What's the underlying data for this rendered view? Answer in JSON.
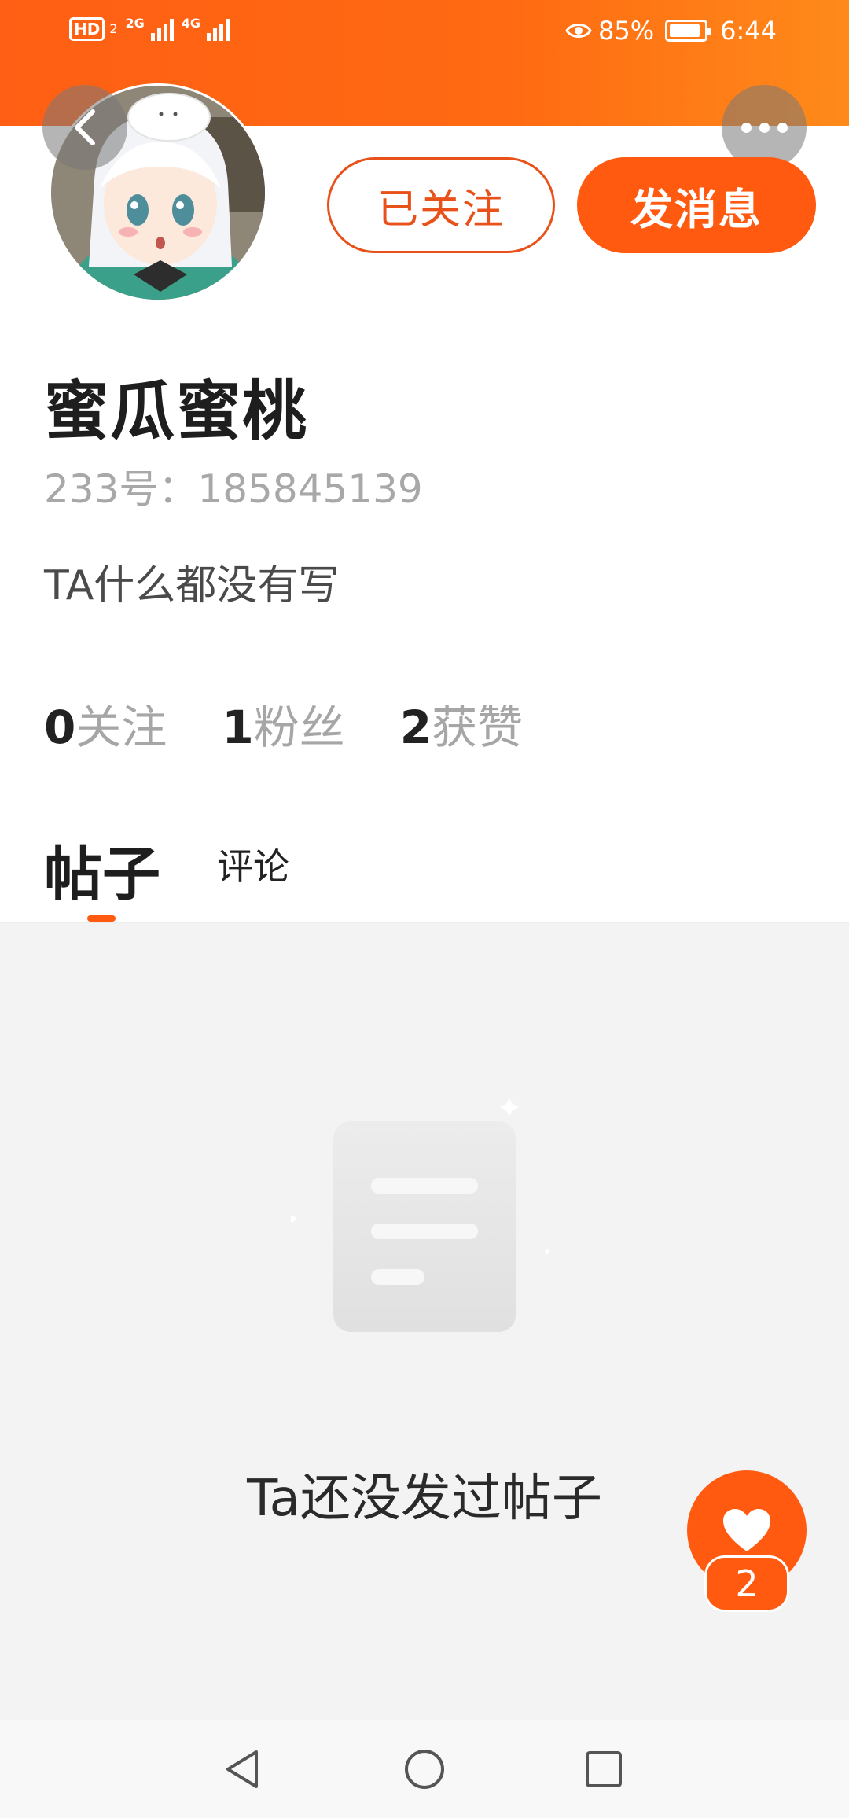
{
  "status_bar": {
    "hd_label": "HD",
    "sim_number": "2",
    "net_type_1": "2G",
    "net_type_2": "4G",
    "battery_percent": "85%",
    "time": "6:44"
  },
  "header": {
    "back_icon": "chevron-left-icon",
    "more_icon": "more-horizontal-icon"
  },
  "profile": {
    "follow_button": "已关注",
    "message_button": "发消息",
    "username": "蜜瓜蜜桃",
    "id_text": "233号：185845139",
    "bio": "TA什么都没有写",
    "stats": [
      {
        "count": "0",
        "label": "关注"
      },
      {
        "count": "1",
        "label": "粉丝"
      },
      {
        "count": "2",
        "label": "获赞"
      }
    ]
  },
  "tabs": {
    "posts": "帖子",
    "comments": "评论",
    "active": "posts"
  },
  "empty_state": {
    "icon": "document-icon",
    "text": "Ta还没发过帖子"
  },
  "like_fab": {
    "icon": "heart-icon",
    "count": "2"
  },
  "nav": {
    "back": "triangle-back-icon",
    "home": "circle-home-icon",
    "recents": "square-recents-icon"
  },
  "colors": {
    "accent": "#ff5a10",
    "follow_outline": "#e8511a"
  }
}
